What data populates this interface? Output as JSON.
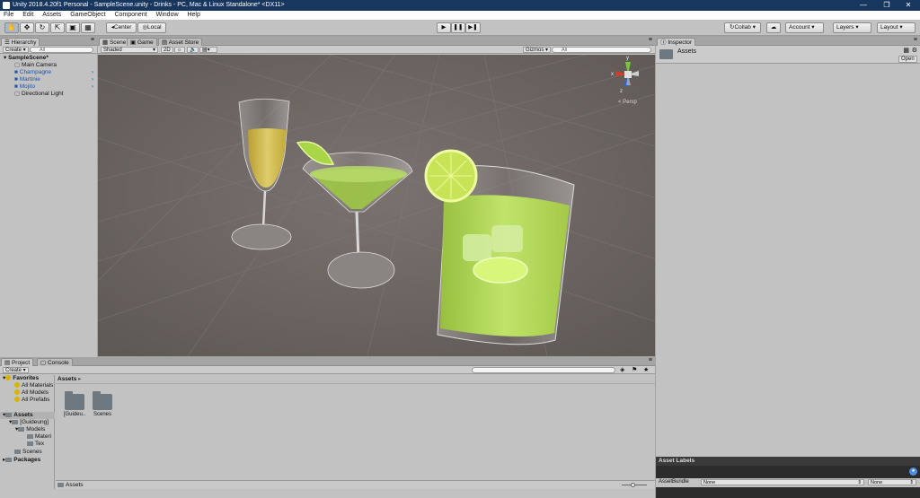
{
  "window": {
    "title": "Unity 2018.4.20f1 Personal - SampleScene.unity - Drinks - PC, Mac & Linux Standalone* <DX11>",
    "minimize": "—",
    "restore": "❐",
    "close": "✕"
  },
  "menu": [
    "File",
    "Edit",
    "Assets",
    "GameObject",
    "Component",
    "Window",
    "Help"
  ],
  "toolbar": {
    "pivot": "◂Center",
    "space": "◎Local",
    "play": "▶",
    "pause": "❚❚",
    "step": "▶❚",
    "collab": "↻Collab ▾",
    "account": "Account",
    "layers": "Layers",
    "layout": "Layout"
  },
  "hierarchy": {
    "tab": "Hierarchy",
    "create": "Create ▾",
    "search_placeholder": "All",
    "scene": "SampleScene*",
    "items": [
      {
        "label": "Main Camera"
      },
      {
        "label": "Champagne"
      },
      {
        "label": "Martinie"
      },
      {
        "label": "Mojito"
      },
      {
        "label": "Directional Light"
      }
    ]
  },
  "scene": {
    "tabs": [
      "Scene",
      "Game",
      "Asset Store"
    ],
    "shading": "Shaded",
    "mode2d": "2D",
    "gizmos": "Gizmos ▾",
    "search_placeholder": "All",
    "persp": "< Persp",
    "axes": {
      "x": "x",
      "y": "y",
      "z": "z"
    }
  },
  "inspector": {
    "tab": "Inspector",
    "title": "Assets",
    "open": "Open",
    "asset_labels": "Asset Labels",
    "asset_bundle": "AssetBundle",
    "bundle_value": "None",
    "variant_value": "None"
  },
  "project": {
    "tabs": [
      "Project",
      "Console"
    ],
    "create": "Create ▾",
    "favorites": "Favorites",
    "fav_items": [
      "All Materials",
      "All Models",
      "All Prefabs"
    ],
    "assets": "Assets",
    "tree": [
      "[Guideung]",
      "Models",
      "Materi",
      "Tex",
      "Scenes"
    ],
    "packages": "Packages",
    "breadcrumb": "Assets",
    "breadcrumb_arrow": "▸",
    "folders": [
      "[Guideu..",
      "Scenes"
    ],
    "footer_path": "Assets"
  },
  "colors": {
    "titlebar": "#17375f",
    "scene_bg": "#6e6763",
    "selection_blue": "#1f56a8",
    "gizmo_x": "#d63c28",
    "gizmo_y": "#78c83a",
    "gizmo_z": "#2f5fd6"
  }
}
